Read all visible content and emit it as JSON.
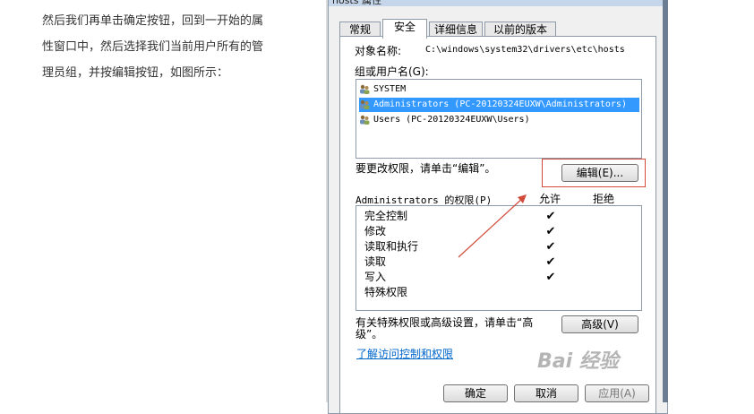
{
  "article": {
    "lines": [
      "然后我们再单击确定按钮，回到一开始的属",
      "性窗口中，然后选择我们当前用户所有的管",
      "理员组，并按编辑按钮，如图所示："
    ]
  },
  "dialog": {
    "title": "hosts 属性",
    "tabs": [
      "常规",
      "安全",
      "详细信息",
      "以前的版本"
    ],
    "object_label": "对象名称:",
    "object_value": "C:\\windows\\system32\\drivers\\etc\\hosts",
    "groups_label": "组或用户名(G):",
    "groups": [
      "SYSTEM",
      "Administrators (PC-20120324EUXW\\Administrators)",
      "Users (PC-20120324EUXW\\Users)"
    ],
    "change_hint": "要更改权限，请单击“编辑”。",
    "edit_button": "编辑(E)...",
    "perm_label": "Administrators 的权限(P)",
    "allow_header": "允许",
    "deny_header": "拒绝",
    "permissions": [
      {
        "name": "完全控制",
        "allow": "✔"
      },
      {
        "name": "修改",
        "allow": "✔"
      },
      {
        "name": "读取和执行",
        "allow": "✔"
      },
      {
        "name": "读取",
        "allow": "✔"
      },
      {
        "name": "写入",
        "allow": "✔"
      },
      {
        "name": "特殊权限",
        "allow": ""
      }
    ],
    "special_hint_line1": "有关特殊权限或高级设置，请单击“高",
    "special_hint_line2": "级”。",
    "advanced_button": "高级(V)",
    "learn_link": "了解访问控制和权限",
    "ok_button": "确定",
    "cancel_button": "取消",
    "apply_button": "应用(A)"
  },
  "watermark": "Bai 经验",
  "colors": {
    "selection": "#3399ff",
    "annotation": "#d24a3a",
    "link": "#0066cc"
  }
}
